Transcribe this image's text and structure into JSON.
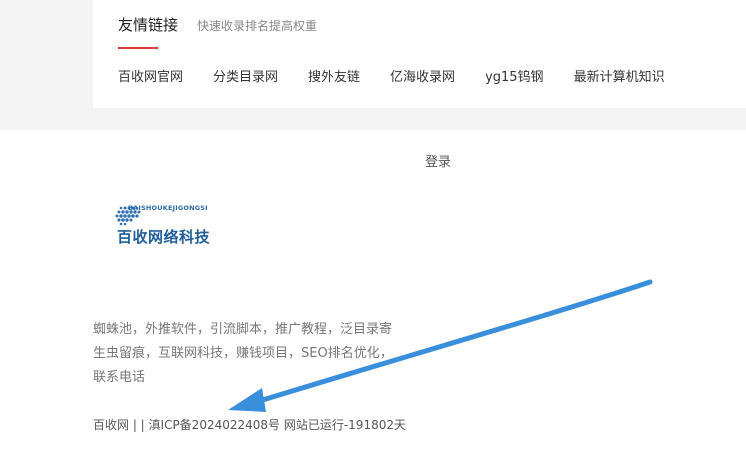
{
  "friend_links": {
    "title": "友情链接",
    "subtitle": "快速收录排名提高权重",
    "items": [
      "百收网官网",
      "分类目录网",
      "搜外友链",
      "亿海收录网",
      "yg15钨钢",
      "最新计算机知识"
    ]
  },
  "login_label": "登录",
  "logo": {
    "small_text": "BAISHOUKEJIGONGSI",
    "big_text": "百收网络科技"
  },
  "footer": {
    "description_lines": [
      "蜘蛛池，外推软件，引流脚本，推广教程，泛目录寄",
      "生虫留痕，互联网科技，赚钱项目，SEO排名优化，",
      "联系电话"
    ],
    "copyright": "百收网 | | 滇ICP备2024022408号 网站已运行-191802天"
  },
  "colors": {
    "accent": "#e5393b",
    "arrow": "#3a8fdc",
    "logo_blue": "#1f5e9a"
  }
}
